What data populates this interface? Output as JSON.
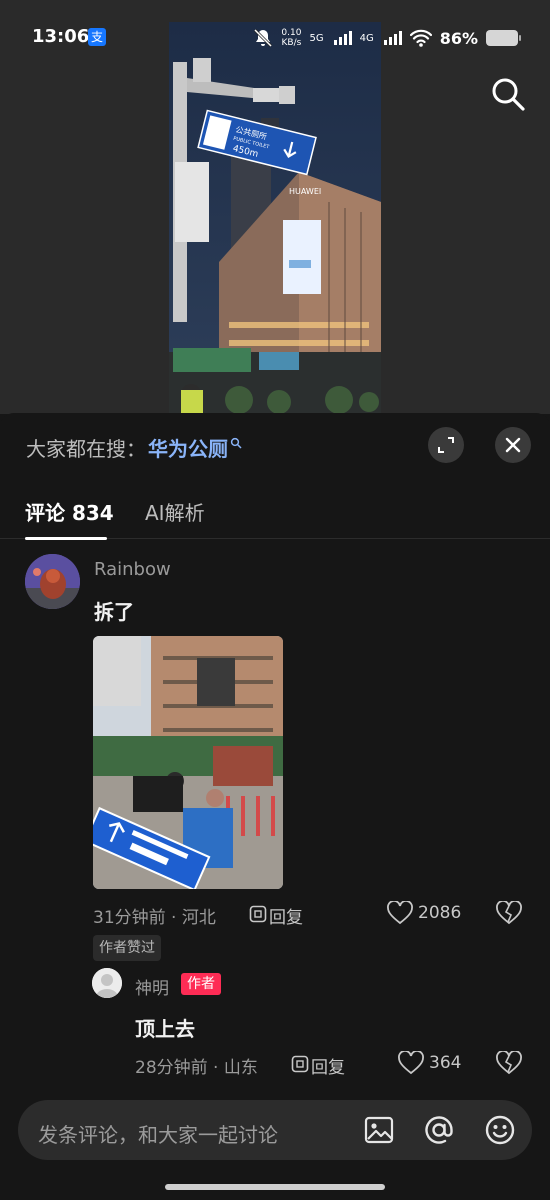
{
  "status_bar": {
    "time": "13:06",
    "app_badge": "支",
    "net_speed_value": "0.10",
    "net_speed_unit": "KB/s",
    "net1": "5G",
    "net2": "4G",
    "battery": "86%"
  },
  "search": {
    "prefix": "大家都在搜：",
    "keyword": "华为公厕"
  },
  "tabs": [
    {
      "label": "评论 834",
      "active": true
    },
    {
      "label": "AI解析",
      "active": false
    }
  ],
  "comment": {
    "username": "Rainbow",
    "text": "拆了",
    "meta": "31分钟前 · 河北",
    "reply_label": "回复",
    "likes": "2086",
    "author_liked_tag": "作者赞过"
  },
  "reply": {
    "username": "神明",
    "badge": "作者",
    "text": "顶上去",
    "meta": "28分钟前 · 山东",
    "reply_label": "回复",
    "likes": "364"
  },
  "video_sign": {
    "line1": "公共厕所",
    "line2": "PUBLIC TOILET",
    "line3": "450m",
    "brand": "HUAWEI"
  },
  "input": {
    "placeholder": "发条评论，和大家一起讨论"
  },
  "icons": {
    "search": "search-icon",
    "expand": "expand-icon",
    "close": "close-icon",
    "like": "heart-icon",
    "dislike": "broken-heart-icon",
    "image": "image-icon",
    "mention": "at-icon",
    "emoji": "emoji-icon"
  },
  "colors": {
    "accent_blue": "#8ab4f8",
    "author_badge": "#fe2c55",
    "panel_bg": "#161616"
  }
}
